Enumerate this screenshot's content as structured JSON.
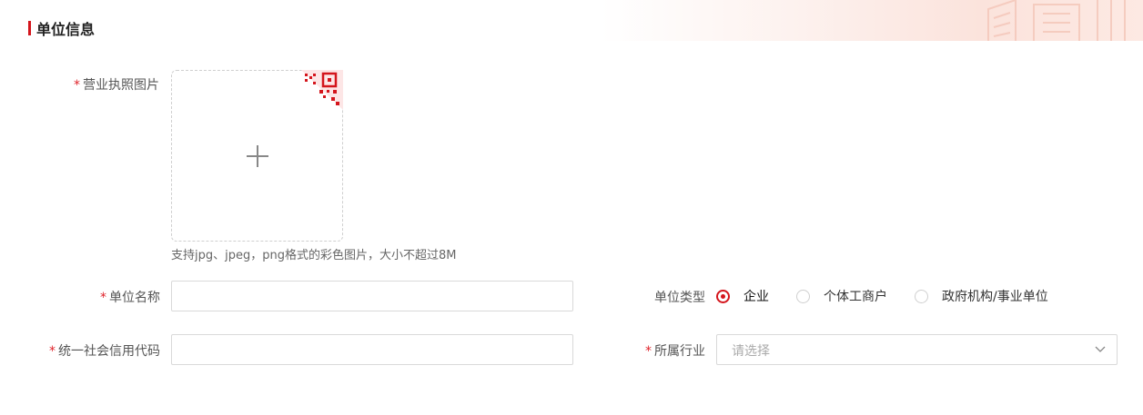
{
  "section": {
    "title": "单位信息"
  },
  "form": {
    "license": {
      "required": "*",
      "label": "营业执照图片",
      "hint": "支持jpg、jpeg，png格式的彩色图片，大小不超过8M"
    },
    "name": {
      "required": "*",
      "label": "单位名称",
      "value": "",
      "placeholder": ""
    },
    "credit_code": {
      "required": "*",
      "label": "统一社会信用代码",
      "value": "",
      "placeholder": ""
    },
    "type": {
      "label": "单位类型",
      "options": [
        {
          "label": "企业",
          "checked": true
        },
        {
          "label": "个体工商户",
          "checked": false
        },
        {
          "label": "政府机构/事业单位",
          "checked": false
        }
      ]
    },
    "industry": {
      "required": "*",
      "label": "所属行业",
      "placeholder": "请选择"
    }
  },
  "colors": {
    "accent": "#d4151c",
    "required": "#e0242b",
    "border": "#d9d9d9"
  },
  "icons": {
    "upload": "plus-icon",
    "qr": "qr-code-icon",
    "dropdown": "chevron-down-icon"
  }
}
